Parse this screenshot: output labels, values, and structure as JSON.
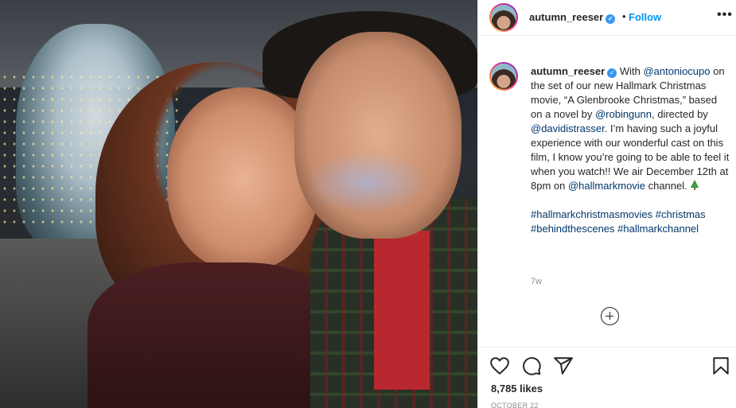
{
  "post": {
    "photo_alt": "Selfie of two people smiling in front of a snowy tree with lights",
    "header": {
      "username": "autumn_reeser",
      "verified_mark": "✓",
      "separator": "•",
      "follow_label": "Follow",
      "more_icon": "more-horizontal-icon",
      "more_label": "•••"
    },
    "caption": {
      "username": "autumn_reeser",
      "t1": " With ",
      "m1": "@antoniocupo",
      "t2": " on the set of our new Hallmark Christmas movie, “A Glenbrooke Christmas,” based on a novel by ",
      "m2": "@robingunn",
      "t3": ", directed by ",
      "m3": "@davidistrasser",
      "t4": ". I’m having such a joyful experience with our wonderful cast on this film, I know you’re going to be able to feel it when you watch!! We air December 12th at 8pm on ",
      "m4": "@hallmarkmovie",
      "t5": " channel. ",
      "emoji_icon": "christmas-tree-icon",
      "hashtags": [
        "#hallmarkchristmasmovies",
        "#christmas",
        "#behindthescenes",
        "#hallmarkchannel"
      ],
      "time_ago": "7w"
    },
    "actions": {
      "like_icon": "heart-icon",
      "comment_icon": "comment-icon",
      "share_icon": "share-icon",
      "save_icon": "bookmark-icon",
      "load_more_icon": "plus-circle-icon"
    },
    "likes": "8,785 likes",
    "date": "OCTOBER 22",
    "colors": {
      "link": "#00376b",
      "follow": "#0095f6",
      "verified": "#3897f0",
      "muted": "#8e8e8e"
    }
  }
}
